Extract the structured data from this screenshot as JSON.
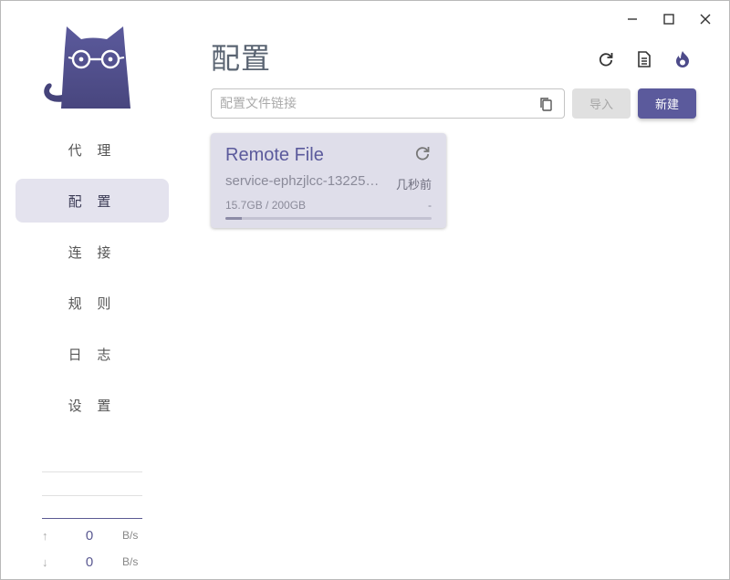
{
  "window": {
    "controls": [
      "minimize-icon",
      "maximize-icon",
      "close-icon"
    ]
  },
  "sidebar": {
    "logo": "cat-with-glasses-logo",
    "items": [
      {
        "label": "代 理",
        "active": false
      },
      {
        "label": "配 置",
        "active": true
      },
      {
        "label": "连 接",
        "active": false
      },
      {
        "label": "规 则",
        "active": false
      },
      {
        "label": "日 志",
        "active": false
      },
      {
        "label": "设 置",
        "active": false
      }
    ],
    "traffic": {
      "upload_value": "0",
      "upload_unit": "B/s",
      "download_value": "0",
      "download_unit": "B/s"
    }
  },
  "main": {
    "title": "配置",
    "top_icons": [
      "refresh-icon",
      "document-icon",
      "fire-icon"
    ],
    "url_input": {
      "value": "",
      "placeholder": "配置文件链接"
    },
    "import_label": "导入",
    "new_label": "新建"
  },
  "profiles": [
    {
      "title": "Remote File",
      "subtitle": "service-ephzjlcc-13225…",
      "updated": "几秒前",
      "usage": "15.7GB / 200GB",
      "expire": "-",
      "usage_fraction": 0.0785
    }
  ],
  "colors": {
    "accent": "#5b5a9c",
    "active_nav_bg": "#e4e3ee",
    "card_bg": "#dfdeea"
  }
}
